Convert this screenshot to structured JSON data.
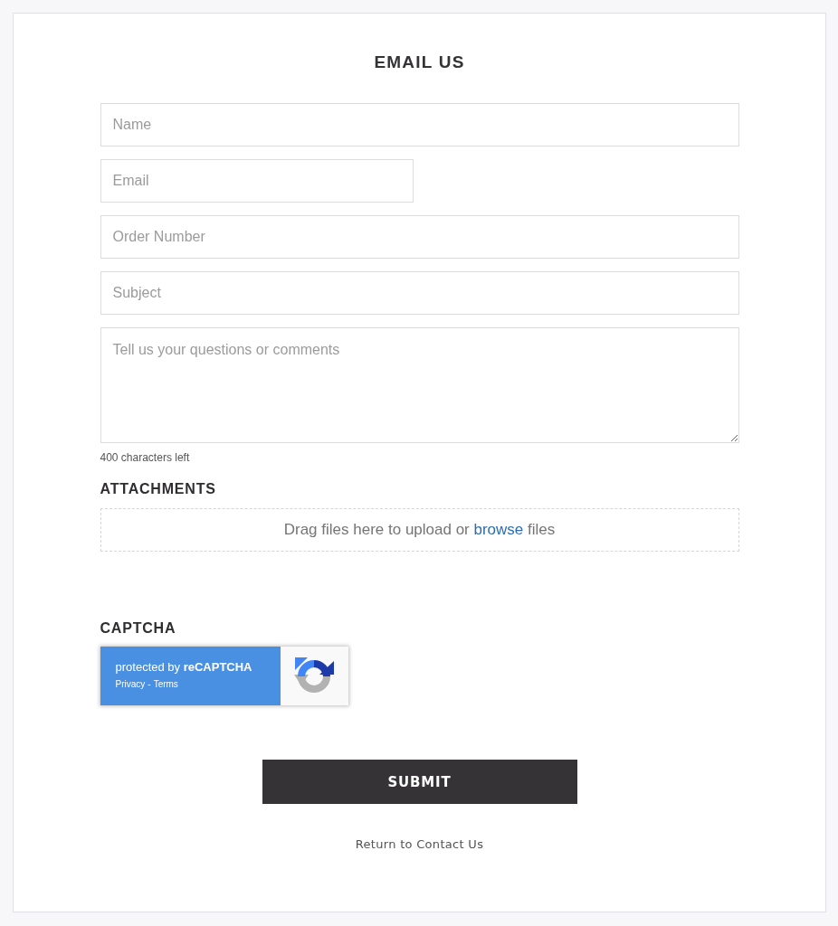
{
  "heading": "EMAIL US",
  "fields": [
    {
      "kind": "text",
      "placeholder": "Name"
    },
    {
      "kind": "email",
      "placeholder": "Email"
    },
    {
      "kind": "text",
      "placeholder": "Order Number"
    },
    {
      "kind": "text",
      "placeholder": "Subject"
    },
    {
      "kind": "textarea",
      "placeholder": "Tell us your questions or comments"
    }
  ],
  "counter": "400 characters left",
  "attachments": {
    "heading": "ATTACHMENTS",
    "prompt_before": "Drag files here to upload or",
    "link": "browse",
    "prompt_after": "files"
  },
  "captcha": {
    "heading": "CAPTCHA",
    "badge_text": "protected by **reCAPTCHA**",
    "links": [
      "Privacy",
      "Terms"
    ],
    "separator": "-"
  },
  "submit_button": "SUBMIT",
  "return_link": "Return to Contact Us"
}
